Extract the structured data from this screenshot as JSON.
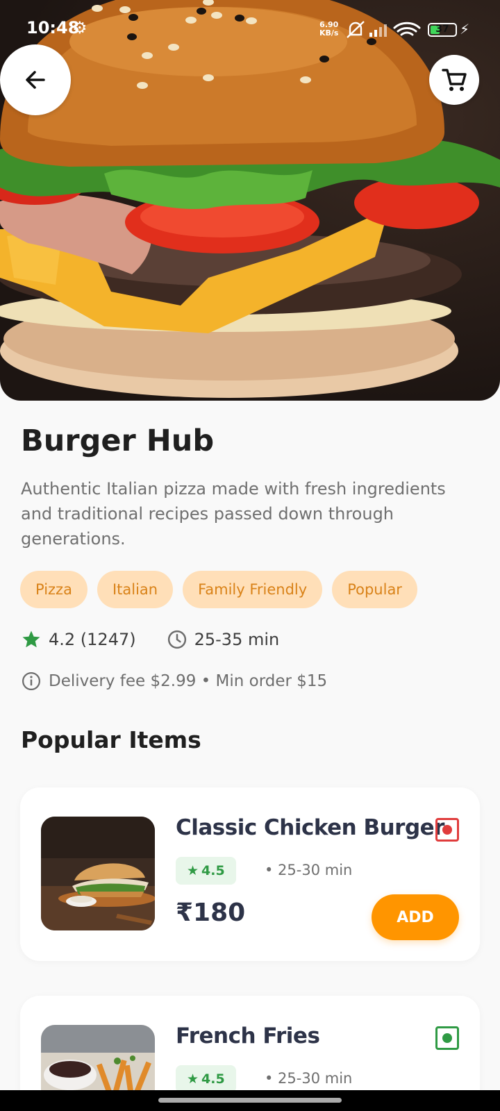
{
  "status_bar": {
    "time": "10:48",
    "net_speed_value": "6.90",
    "net_speed_unit": "KB/s",
    "battery": "37",
    "battery_level": 0.37
  },
  "header": {
    "back_icon": "arrow-left-icon",
    "cart_icon": "cart-icon"
  },
  "restaurant": {
    "name": "Burger Hub",
    "description": "Authentic Italian pizza made with fresh ingredients and traditional recipes passed down through generations.",
    "tags": [
      "Pizza",
      "Italian",
      "Family Friendly",
      "Popular"
    ],
    "rating": "4.2 (1247)",
    "delivery_time": "25-35 min",
    "fee_info": "Delivery fee $2.99 • Min order $15"
  },
  "section_title": "Popular Items",
  "items": [
    {
      "name": "Classic Chicken Burger",
      "rating": "4.5",
      "time": "• 25-30 min",
      "price": "₹180",
      "add_label": "ADD",
      "veg": false
    },
    {
      "name": "French Fries",
      "rating": "4.5",
      "time": "• 25-30 min",
      "price": "",
      "add_label": "",
      "veg": true
    }
  ],
  "colors": {
    "accent": "#ff9500",
    "tag_bg": "#ffdfb8",
    "tag_text": "#d98218",
    "rating_green": "#2f9a44",
    "nonveg_red": "#e03c3c",
    "veg_green": "#2f9a44"
  }
}
